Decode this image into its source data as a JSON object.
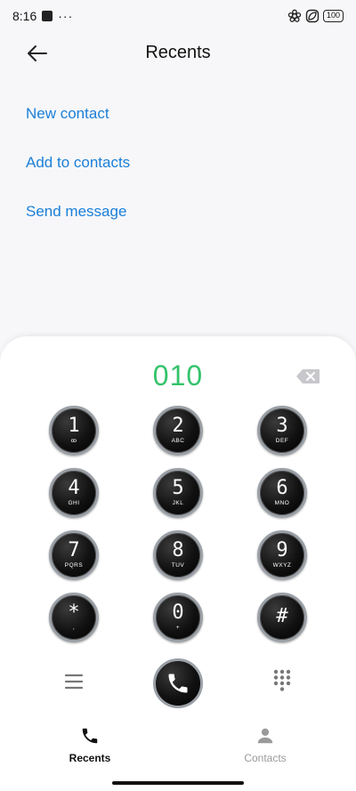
{
  "status": {
    "time": "8:16",
    "dots": "···",
    "battery": "100"
  },
  "header": {
    "title": "Recents"
  },
  "actions": [
    {
      "label": "New contact"
    },
    {
      "label": "Add to contacts"
    },
    {
      "label": "Send message"
    }
  ],
  "dialer": {
    "number": "010",
    "keys": [
      {
        "digit": "1",
        "letters": "ꝏ"
      },
      {
        "digit": "2",
        "letters": "ABC"
      },
      {
        "digit": "3",
        "letters": "DEF"
      },
      {
        "digit": "4",
        "letters": "GHI"
      },
      {
        "digit": "5",
        "letters": "JKL"
      },
      {
        "digit": "6",
        "letters": "MNO"
      },
      {
        "digit": "7",
        "letters": "PQRS"
      },
      {
        "digit": "8",
        "letters": "TUV"
      },
      {
        "digit": "9",
        "letters": "WXYZ"
      },
      {
        "digit": "*",
        "letters": ","
      },
      {
        "digit": "0",
        "letters": "+"
      },
      {
        "digit": "#",
        "letters": ""
      }
    ]
  },
  "nav": {
    "recents": "Recents",
    "contacts": "Contacts"
  },
  "colors": {
    "accent": "#1a7fd8",
    "number": "#34c36b"
  }
}
